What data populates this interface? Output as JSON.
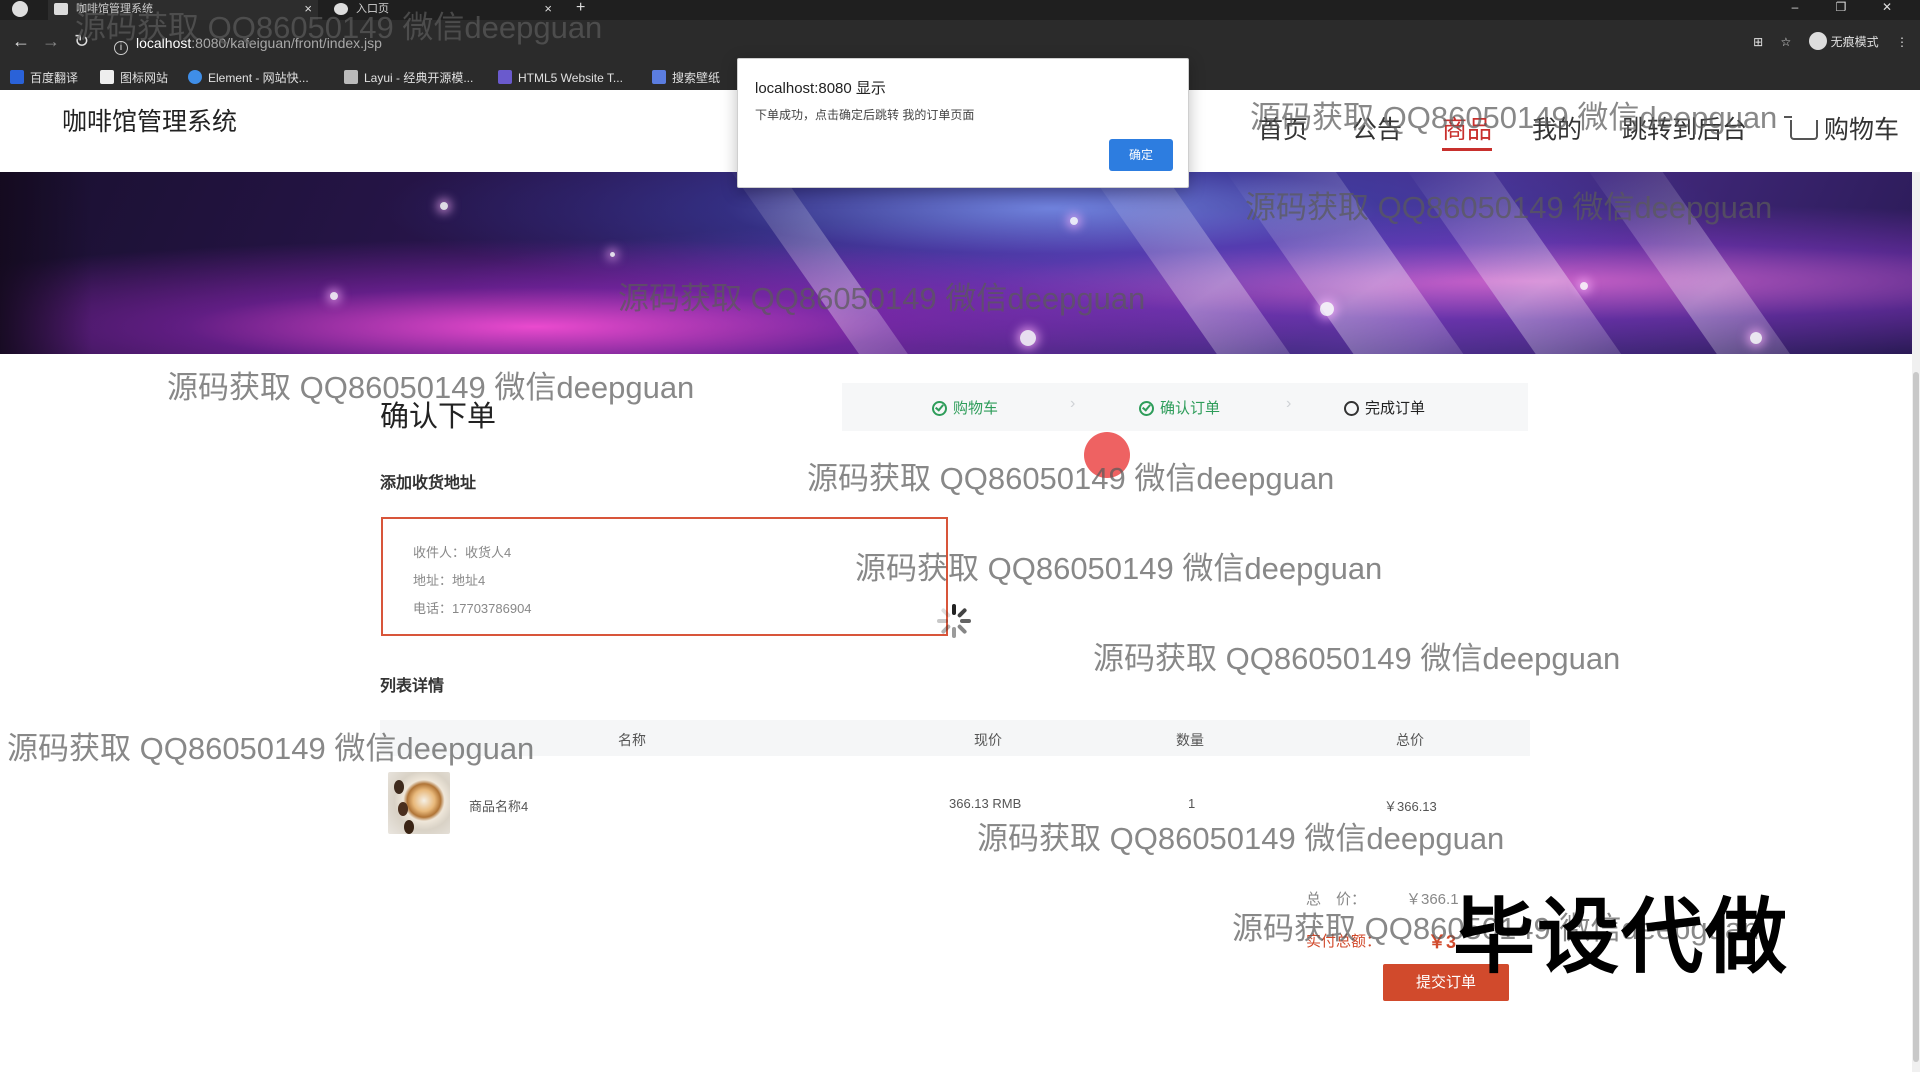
{
  "browser": {
    "tabs": [
      {
        "title": "咖啡馆管理系统",
        "close": "×"
      },
      {
        "title": "入口页",
        "close": "×"
      }
    ],
    "new_tab": "+",
    "window_controls": [
      "–",
      "❐",
      "✕"
    ],
    "url_host": "localhost",
    "url_path": ":8080/kafeiguan/front/index.jsp",
    "profile_label": "无痕模式",
    "bookmarks": [
      {
        "label": "百度翻译",
        "color": "#2a62d8"
      },
      {
        "label": "图标网站",
        "color": "#eeeeee"
      },
      {
        "label": "Element - 网站快...",
        "color": "#3f8ee8"
      },
      {
        "label": "Layui - 经典开源模...",
        "color": "#bbbbbb"
      },
      {
        "label": "HTML5 Website T...",
        "color": "#6a5acd"
      },
      {
        "label": "搜索壁纸",
        "color": "#5b7de0"
      }
    ]
  },
  "header": {
    "brand": "咖啡馆管理系统",
    "nav": [
      "首页",
      "公告",
      "商品",
      "我的",
      "跳转到后台"
    ],
    "active_nav": "商品",
    "cart": "购物车"
  },
  "dialog": {
    "title": "localhost:8080 显示",
    "message": "下单成功，点击确定后跳转 我的订单页面",
    "ok": "确定"
  },
  "order": {
    "title": "确认下单",
    "steps": [
      {
        "label": "购物车",
        "state": "done"
      },
      {
        "label": "确认订单",
        "state": "done"
      },
      {
        "label": "完成订单",
        "state": "todo"
      }
    ],
    "address_section": "添加收货地址",
    "address": {
      "recipient": "收件人：收货人4",
      "addr": "地址：地址4",
      "phone": "电话：17703786904"
    },
    "list_section": "列表详情",
    "columns": [
      "名称",
      "现价",
      "数量",
      "总价"
    ],
    "items": [
      {
        "name": "商品名称4",
        "price": "366.13 RMB",
        "qty": "1",
        "total": "￥366.13"
      }
    ],
    "total_label": "总　价：",
    "total_value": "￥366.1",
    "paid_label": "实付总额：",
    "paid_value": "￥3",
    "submit": "提交订单"
  },
  "watermark": "源码获取 QQ86050149 微信deepguan",
  "stamp": "毕设代做"
}
